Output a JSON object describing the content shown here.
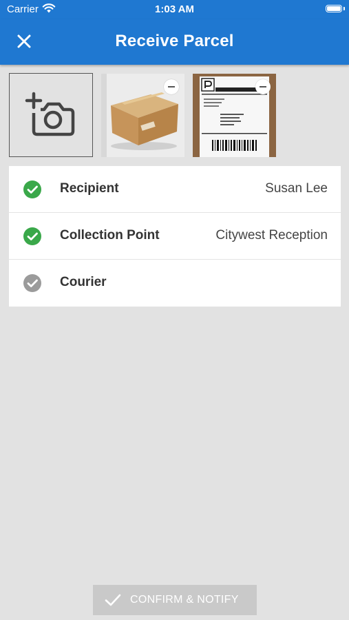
{
  "status_bar": {
    "carrier": "Carrier",
    "time": "1:03 AM"
  },
  "navbar": {
    "title": "Receive Parcel",
    "close_icon": "close-icon"
  },
  "photos": {
    "add_icon": "add-photo-icon",
    "items": [
      {
        "name": "parcel-box-photo"
      },
      {
        "name": "shipping-label-photo"
      }
    ]
  },
  "fields": [
    {
      "label": "Recipient",
      "value": "Susan Lee",
      "status": "complete"
    },
    {
      "label": "Collection Point",
      "value": "Citywest Reception",
      "status": "complete"
    },
    {
      "label": "Courier",
      "value": "",
      "status": "incomplete"
    }
  ],
  "confirm": {
    "label": "CONFIRM & NOTIFY",
    "enabled": false
  },
  "colors": {
    "primary": "#1f78d1",
    "check_complete": "#3aa84a",
    "check_incomplete": "#9b9b9b",
    "background": "#e2e2e2",
    "button_disabled": "#c9c9c9"
  }
}
